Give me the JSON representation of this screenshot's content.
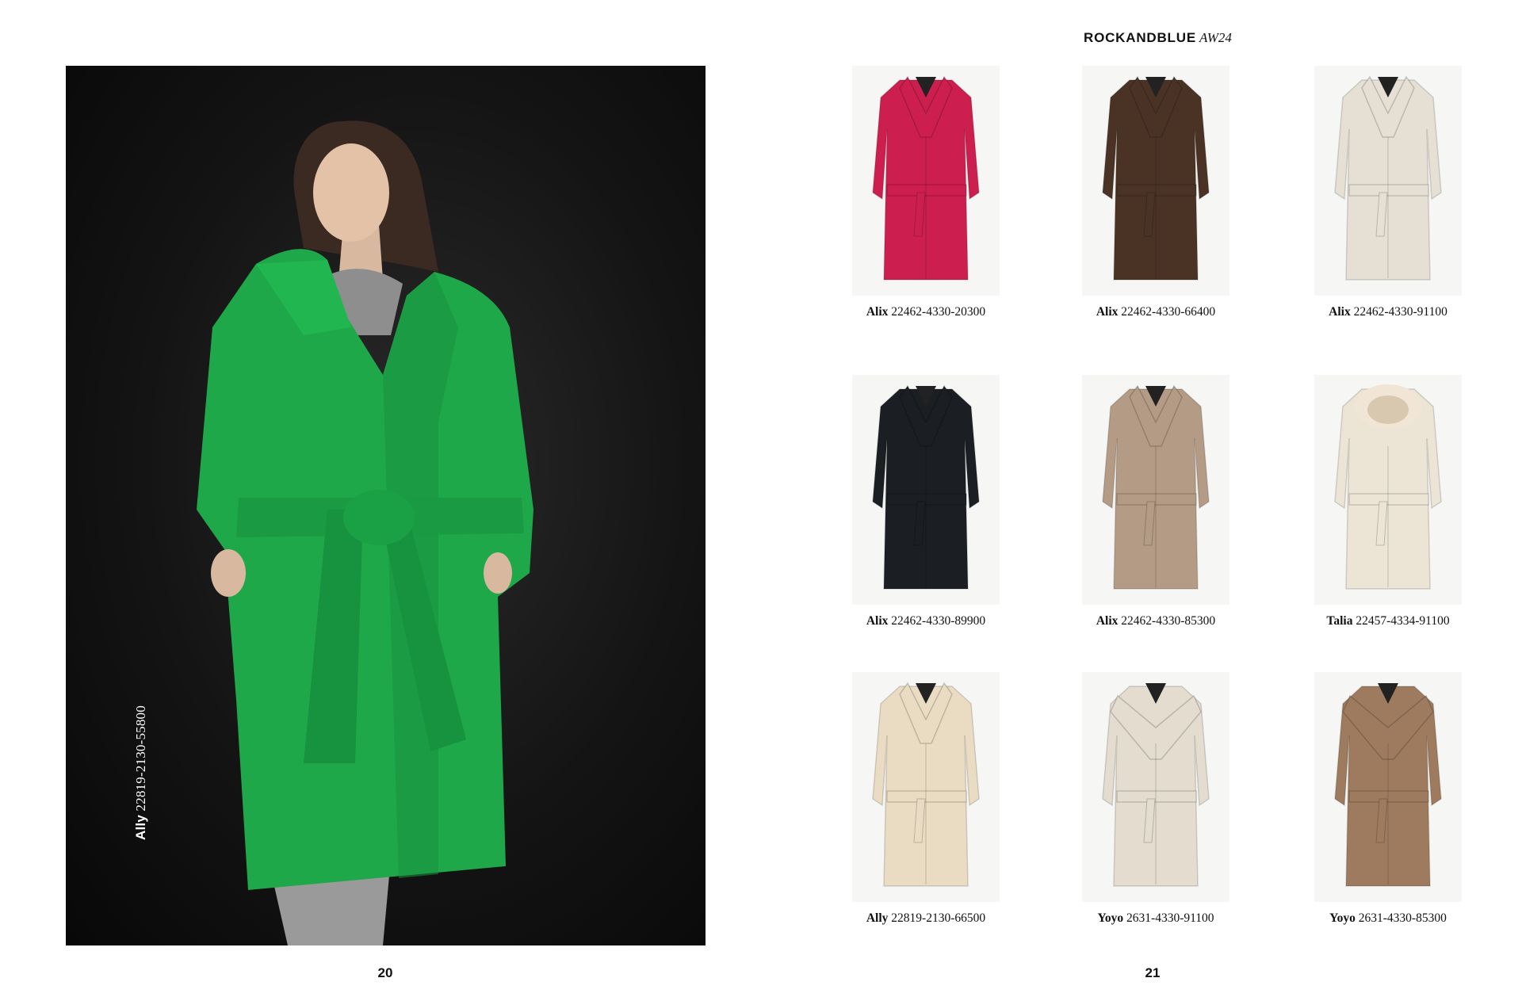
{
  "header": {
    "brand": "ROCKANDBLUE",
    "season": "AW24"
  },
  "feature": {
    "name": "Ally",
    "code": "22819-2130-55800"
  },
  "pages": {
    "left": "20",
    "right": "21"
  },
  "colors": {
    "feature_coat": "#1fa84a",
    "background_dark": "#121212"
  },
  "products": [
    {
      "name": "Alix",
      "code": "22462-4330-20300",
      "color": "#cc1f4f",
      "icon": "coat-wrap"
    },
    {
      "name": "Alix",
      "code": "22462-4330-66400",
      "color": "#4a3325",
      "icon": "coat-wrap"
    },
    {
      "name": "Alix",
      "code": "22462-4330-91100",
      "color": "#e6e0d4",
      "icon": "coat-wrap"
    },
    {
      "name": "Alix",
      "code": "22462-4330-89900",
      "color": "#1b1e22",
      "icon": "coat-wrap"
    },
    {
      "name": "Alix",
      "code": "22462-4330-85300",
      "color": "#b39b85",
      "icon": "coat-wrap"
    },
    {
      "name": "Talia",
      "code": "22457-4334-91100",
      "color": "#ece5d6",
      "icon": "coat-fur-hood"
    },
    {
      "name": "Ally",
      "code": "22819-2130-66500",
      "color": "#e9dcc3",
      "icon": "coat-wrap"
    },
    {
      "name": "Yoyo",
      "code": "2631-4330-91100",
      "color": "#e3dccf",
      "icon": "coat-wide-collar"
    },
    {
      "name": "Yoyo",
      "code": "2631-4330-85300",
      "color": "#9e7b5e",
      "icon": "coat-wide-collar"
    }
  ]
}
